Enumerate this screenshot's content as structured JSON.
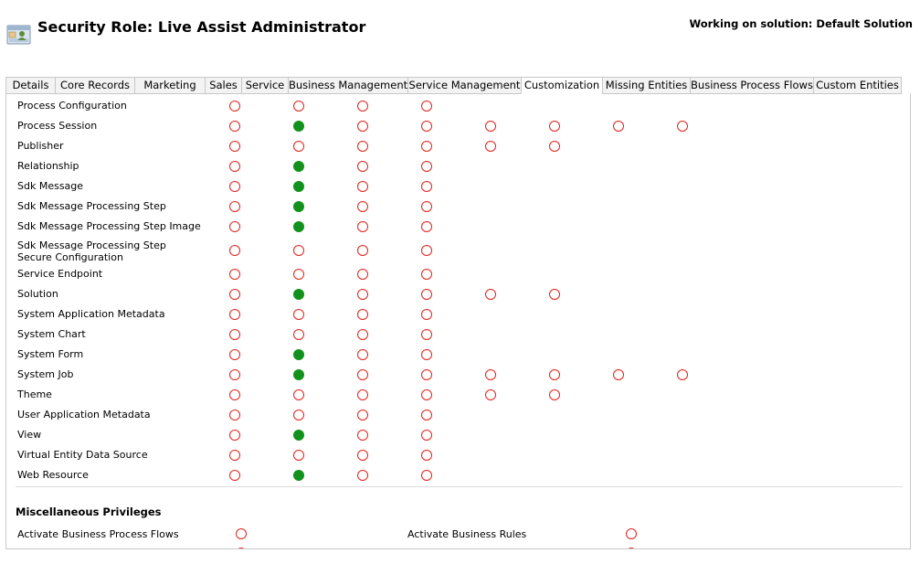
{
  "header": {
    "title": "Security Role: Live Assist Administrator",
    "solution": "Working on solution: Default Solution"
  },
  "tabs": [
    {
      "label": "Details",
      "active": false
    },
    {
      "label": "Core Records",
      "active": false
    },
    {
      "label": "Marketing",
      "active": false
    },
    {
      "label": "Sales",
      "active": false
    },
    {
      "label": "Service",
      "active": false
    },
    {
      "label": "Business Management",
      "active": false
    },
    {
      "label": "Service Management",
      "active": false
    },
    {
      "label": "Customization",
      "active": true
    },
    {
      "label": "Missing Entities",
      "active": false
    },
    {
      "label": "Business Process Flows",
      "active": false
    },
    {
      "label": "Custom Entities",
      "active": false
    }
  ],
  "entities": [
    {
      "name": "Process Configuration",
      "privileges": [
        "none",
        "none",
        "none",
        "none"
      ]
    },
    {
      "name": "Process Session",
      "privileges": [
        "none",
        "full",
        "none",
        "none",
        "none",
        "none",
        "none",
        "none"
      ]
    },
    {
      "name": "Publisher",
      "privileges": [
        "none",
        "none",
        "none",
        "none",
        "none",
        "none"
      ]
    },
    {
      "name": "Relationship",
      "privileges": [
        "none",
        "full",
        "none",
        "none"
      ]
    },
    {
      "name": "Sdk Message",
      "privileges": [
        "none",
        "full",
        "none",
        "none"
      ]
    },
    {
      "name": "Sdk Message Processing Step",
      "privileges": [
        "none",
        "full",
        "none",
        "none"
      ]
    },
    {
      "name": "Sdk Message Processing Step Image",
      "privileges": [
        "none",
        "full",
        "none",
        "none"
      ]
    },
    {
      "name": "Sdk Message Processing Step Secure Configuration",
      "privileges": [
        "none",
        "none",
        "none",
        "none"
      ]
    },
    {
      "name": "Service Endpoint",
      "privileges": [
        "none",
        "none",
        "none",
        "none"
      ]
    },
    {
      "name": "Solution",
      "privileges": [
        "none",
        "full",
        "none",
        "none",
        "none",
        "none"
      ]
    },
    {
      "name": "System Application Metadata",
      "privileges": [
        "none",
        "none",
        "none",
        "none"
      ]
    },
    {
      "name": "System Chart",
      "privileges": [
        "none",
        "none",
        "none",
        "none"
      ]
    },
    {
      "name": "System Form",
      "privileges": [
        "none",
        "full",
        "none",
        "none"
      ]
    },
    {
      "name": "System Job",
      "privileges": [
        "none",
        "full",
        "none",
        "none",
        "none",
        "none",
        "none",
        "none"
      ]
    },
    {
      "name": "Theme",
      "privileges": [
        "none",
        "none",
        "none",
        "none",
        "none",
        "none"
      ]
    },
    {
      "name": "User Application Metadata",
      "privileges": [
        "none",
        "none",
        "none",
        "none"
      ]
    },
    {
      "name": "View",
      "privileges": [
        "none",
        "full",
        "none",
        "none"
      ]
    },
    {
      "name": "Virtual Entity Data Source",
      "privileges": [
        "none",
        "none",
        "none",
        "none"
      ]
    },
    {
      "name": "Web Resource",
      "privileges": [
        "none",
        "full",
        "none",
        "none"
      ]
    }
  ],
  "misc": {
    "title": "Miscellaneous Privileges",
    "items": [
      {
        "label": "Activate Business Process Flows",
        "privilege": "none"
      },
      {
        "label": "Activate Business Rules",
        "privilege": "none"
      }
    ]
  },
  "colors": {
    "none_privilege": "#e0221c",
    "full_privilege": "#12921c",
    "border": "#c8c8c8"
  }
}
